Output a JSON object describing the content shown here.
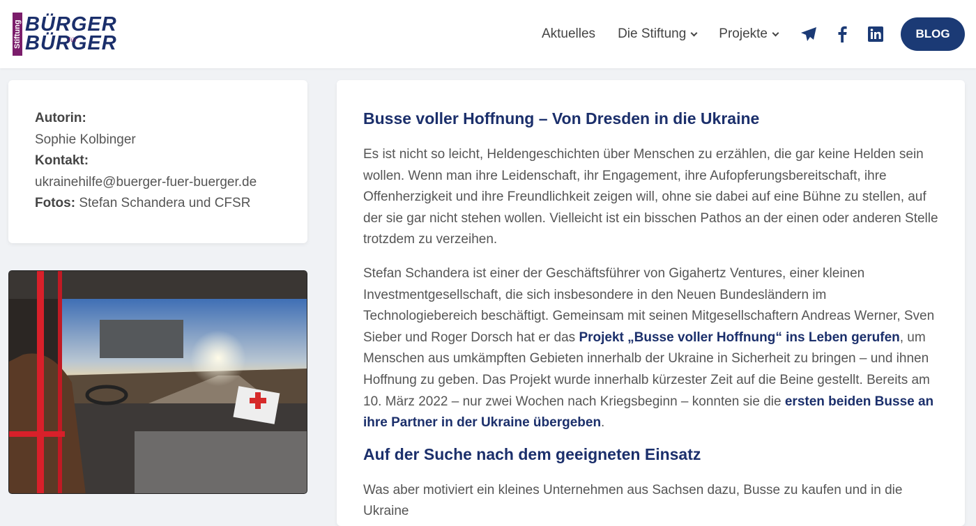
{
  "logo": {
    "stiftung": "Stiftung",
    "line1": "BÜRGER",
    "fuer": "für",
    "line2": "BÜRGER"
  },
  "nav": {
    "items": [
      "Aktuelles",
      "Die Stiftung",
      "Projekte"
    ],
    "blog": "BLOG",
    "icons": [
      "telegram-icon",
      "facebook-icon",
      "linkedin-icon"
    ]
  },
  "sidebar": {
    "author_label": "Autorin:",
    "author": "Sophie Kolbinger",
    "contact_label": "Kontakt:",
    "contact": "ukrainehilfe@buerger-fuer-buerger.de",
    "photos_label": "Fotos:",
    "photos": "Stefan Schandera und CFSR"
  },
  "article": {
    "title": "Busse voller Hoffnung – Von Dresden in die Ukraine",
    "p1": "Es ist nicht so leicht, Heldengeschichten über Menschen zu erzählen, die gar keine Helden sein wollen. Wenn man ihre Leidenschaft, ihr Engagement, ihre Aufopferungsbereitschaft, ihre Offenherzigkeit und ihre Freundlichkeit zeigen will, ohne sie dabei auf eine Bühne zu stellen, auf der sie gar nicht stehen wollen. Vielleicht ist ein bisschen Pathos an der einen oder anderen Stelle trotzdem zu verzeihen.",
    "p2a": "Stefan Schandera ist einer der Geschäftsführer von Gigahertz Ventures, einer kleinen Investmentgesellschaft, die sich insbesondere in den Neuen Bundesländern im Technologiebereich beschäftigt. Gemeinsam mit seinen Mitgesellschaftern Andreas Werner, Sven Sieber und Roger Dorsch hat er das ",
    "link1": "Projekt „Busse voller Hoffnung“ ins Leben gerufen",
    "p2b": ", um Menschen aus umkämpften Gebieten innerhalb der Ukraine in Sicherheit zu bringen – und ihnen Hoffnung zu geben. Das Projekt wurde innerhalb kürzester Zeit auf die Beine gestellt. Bereits am 10. März 2022 – nur zwei Wochen nach Kriegsbeginn – konnten sie die ",
    "link2": "ersten beiden Busse an ihre Partner in der Ukraine übergeben",
    "p2c": ".",
    "subtitle": "Auf der Suche nach dem geeigneten Einsatz",
    "p3": "Was aber motiviert ein kleines Unternehmen aus Sachsen dazu, Busse zu kaufen und in die Ukraine"
  }
}
